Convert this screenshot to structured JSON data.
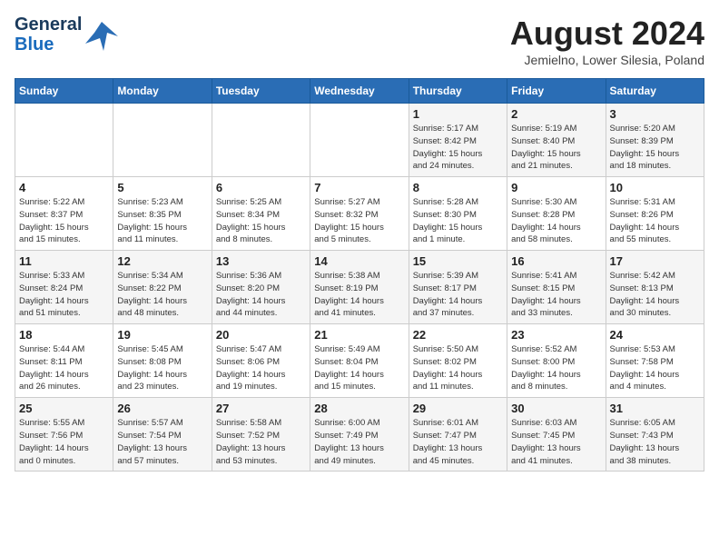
{
  "header": {
    "logo_line1": "General",
    "logo_line2": "Blue",
    "title": "August 2024",
    "subtitle": "Jemielno, Lower Silesia, Poland"
  },
  "weekdays": [
    "Sunday",
    "Monday",
    "Tuesday",
    "Wednesday",
    "Thursday",
    "Friday",
    "Saturday"
  ],
  "weeks": [
    [
      {
        "day": "",
        "info": ""
      },
      {
        "day": "",
        "info": ""
      },
      {
        "day": "",
        "info": ""
      },
      {
        "day": "",
        "info": ""
      },
      {
        "day": "1",
        "info": "Sunrise: 5:17 AM\nSunset: 8:42 PM\nDaylight: 15 hours\nand 24 minutes."
      },
      {
        "day": "2",
        "info": "Sunrise: 5:19 AM\nSunset: 8:40 PM\nDaylight: 15 hours\nand 21 minutes."
      },
      {
        "day": "3",
        "info": "Sunrise: 5:20 AM\nSunset: 8:39 PM\nDaylight: 15 hours\nand 18 minutes."
      }
    ],
    [
      {
        "day": "4",
        "info": "Sunrise: 5:22 AM\nSunset: 8:37 PM\nDaylight: 15 hours\nand 15 minutes."
      },
      {
        "day": "5",
        "info": "Sunrise: 5:23 AM\nSunset: 8:35 PM\nDaylight: 15 hours\nand 11 minutes."
      },
      {
        "day": "6",
        "info": "Sunrise: 5:25 AM\nSunset: 8:34 PM\nDaylight: 15 hours\nand 8 minutes."
      },
      {
        "day": "7",
        "info": "Sunrise: 5:27 AM\nSunset: 8:32 PM\nDaylight: 15 hours\nand 5 minutes."
      },
      {
        "day": "8",
        "info": "Sunrise: 5:28 AM\nSunset: 8:30 PM\nDaylight: 15 hours\nand 1 minute."
      },
      {
        "day": "9",
        "info": "Sunrise: 5:30 AM\nSunset: 8:28 PM\nDaylight: 14 hours\nand 58 minutes."
      },
      {
        "day": "10",
        "info": "Sunrise: 5:31 AM\nSunset: 8:26 PM\nDaylight: 14 hours\nand 55 minutes."
      }
    ],
    [
      {
        "day": "11",
        "info": "Sunrise: 5:33 AM\nSunset: 8:24 PM\nDaylight: 14 hours\nand 51 minutes."
      },
      {
        "day": "12",
        "info": "Sunrise: 5:34 AM\nSunset: 8:22 PM\nDaylight: 14 hours\nand 48 minutes."
      },
      {
        "day": "13",
        "info": "Sunrise: 5:36 AM\nSunset: 8:20 PM\nDaylight: 14 hours\nand 44 minutes."
      },
      {
        "day": "14",
        "info": "Sunrise: 5:38 AM\nSunset: 8:19 PM\nDaylight: 14 hours\nand 41 minutes."
      },
      {
        "day": "15",
        "info": "Sunrise: 5:39 AM\nSunset: 8:17 PM\nDaylight: 14 hours\nand 37 minutes."
      },
      {
        "day": "16",
        "info": "Sunrise: 5:41 AM\nSunset: 8:15 PM\nDaylight: 14 hours\nand 33 minutes."
      },
      {
        "day": "17",
        "info": "Sunrise: 5:42 AM\nSunset: 8:13 PM\nDaylight: 14 hours\nand 30 minutes."
      }
    ],
    [
      {
        "day": "18",
        "info": "Sunrise: 5:44 AM\nSunset: 8:11 PM\nDaylight: 14 hours\nand 26 minutes."
      },
      {
        "day": "19",
        "info": "Sunrise: 5:45 AM\nSunset: 8:08 PM\nDaylight: 14 hours\nand 23 minutes."
      },
      {
        "day": "20",
        "info": "Sunrise: 5:47 AM\nSunset: 8:06 PM\nDaylight: 14 hours\nand 19 minutes."
      },
      {
        "day": "21",
        "info": "Sunrise: 5:49 AM\nSunset: 8:04 PM\nDaylight: 14 hours\nand 15 minutes."
      },
      {
        "day": "22",
        "info": "Sunrise: 5:50 AM\nSunset: 8:02 PM\nDaylight: 14 hours\nand 11 minutes."
      },
      {
        "day": "23",
        "info": "Sunrise: 5:52 AM\nSunset: 8:00 PM\nDaylight: 14 hours\nand 8 minutes."
      },
      {
        "day": "24",
        "info": "Sunrise: 5:53 AM\nSunset: 7:58 PM\nDaylight: 14 hours\nand 4 minutes."
      }
    ],
    [
      {
        "day": "25",
        "info": "Sunrise: 5:55 AM\nSunset: 7:56 PM\nDaylight: 14 hours\nand 0 minutes."
      },
      {
        "day": "26",
        "info": "Sunrise: 5:57 AM\nSunset: 7:54 PM\nDaylight: 13 hours\nand 57 minutes."
      },
      {
        "day": "27",
        "info": "Sunrise: 5:58 AM\nSunset: 7:52 PM\nDaylight: 13 hours\nand 53 minutes."
      },
      {
        "day": "28",
        "info": "Sunrise: 6:00 AM\nSunset: 7:49 PM\nDaylight: 13 hours\nand 49 minutes."
      },
      {
        "day": "29",
        "info": "Sunrise: 6:01 AM\nSunset: 7:47 PM\nDaylight: 13 hours\nand 45 minutes."
      },
      {
        "day": "30",
        "info": "Sunrise: 6:03 AM\nSunset: 7:45 PM\nDaylight: 13 hours\nand 41 minutes."
      },
      {
        "day": "31",
        "info": "Sunrise: 6:05 AM\nSunset: 7:43 PM\nDaylight: 13 hours\nand 38 minutes."
      }
    ]
  ]
}
